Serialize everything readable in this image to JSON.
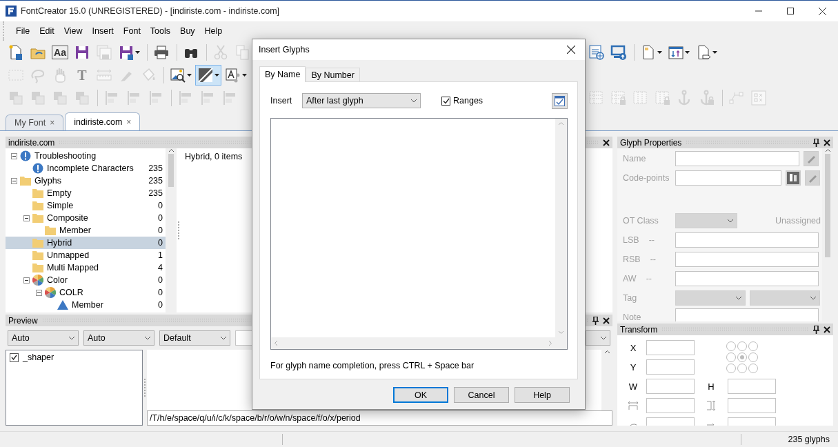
{
  "window": {
    "title": "FontCreator 15.0 (UNREGISTERED) - [indiriste.com - indiriste.com]"
  },
  "menu": [
    "File",
    "Edit",
    "View",
    "Insert",
    "Font",
    "Tools",
    "Buy",
    "Help"
  ],
  "toolbars": [
    {
      "left": [
        [
          {
            "kind": "new",
            "disabled": false,
            "pressed": false
          },
          {
            "kind": "open",
            "disabled": false,
            "pressed": false
          },
          {
            "kind": "sample",
            "label": "Aa",
            "disabled": false,
            "pressed": false
          },
          {
            "kind": "save",
            "disabled": false,
            "pressed": false
          },
          {
            "kind": "saveall",
            "disabled": true,
            "pressed": false
          },
          {
            "kind": "saveas",
            "disabled": false,
            "pressed": false
          }
        ],
        [
          {
            "kind": "print",
            "disabled": false,
            "pressed": false
          }
        ],
        [
          {
            "kind": "find",
            "disabled": false,
            "pressed": false
          }
        ],
        [
          {
            "kind": "cut",
            "disabled": true,
            "pressed": false
          },
          {
            "kind": "copy",
            "disabled": true,
            "pressed": false
          }
        ]
      ],
      "right": [
        [
          {
            "kind": "web",
            "disabled": false,
            "pressed": false
          },
          {
            "kind": "publish",
            "disabled": false,
            "pressed": false
          }
        ],
        [
          {
            "kind": "page",
            "disabled": false,
            "pressed": false
          },
          {
            "kind": "sort",
            "disabled": false,
            "pressed": false
          },
          {
            "kind": "export",
            "disabled": false,
            "pressed": false
          }
        ]
      ]
    },
    {
      "left": [
        [
          {
            "kind": "select",
            "disabled": true,
            "pressed": false
          },
          {
            "kind": "lasso",
            "disabled": true,
            "pressed": false
          },
          {
            "kind": "hand",
            "disabled": true,
            "pressed": false
          },
          {
            "kind": "text",
            "label": "T",
            "disabled": true,
            "pressed": false
          },
          {
            "kind": "measure",
            "disabled": true,
            "pressed": false
          },
          {
            "kind": "knife",
            "disabled": true,
            "pressed": false
          },
          {
            "kind": "fill",
            "disabled": true,
            "pressed": false
          }
        ],
        [
          {
            "kind": "imagezoom",
            "disabled": false,
            "pressed": false
          },
          {
            "kind": "contour",
            "disabled": false,
            "pressed": true
          },
          {
            "kind": "textstyle",
            "disabled": false,
            "pressed": false
          }
        ]
      ]
    },
    {
      "left": [
        [
          {
            "kind": "arrange",
            "disabled": true,
            "pressed": false
          },
          {
            "kind": "arrange",
            "disabled": true,
            "pressed": false
          },
          {
            "kind": "arrange",
            "disabled": true,
            "pressed": false
          },
          {
            "kind": "arrange",
            "disabled": true,
            "pressed": false
          }
        ],
        [
          {
            "kind": "align",
            "disabled": true,
            "pressed": false
          },
          {
            "kind": "align",
            "disabled": true,
            "pressed": false
          },
          {
            "kind": "align",
            "disabled": true,
            "pressed": false
          }
        ],
        [
          {
            "kind": "align",
            "disabled": true,
            "pressed": false
          },
          {
            "kind": "align",
            "disabled": true,
            "pressed": false
          },
          {
            "kind": "align",
            "disabled": true,
            "pressed": false
          }
        ]
      ],
      "right": [
        [
          {
            "kind": "table",
            "disabled": true,
            "pressed": false
          },
          {
            "kind": "tablelock",
            "disabled": true,
            "pressed": false
          },
          {
            "kind": "grid",
            "disabled": true,
            "pressed": false
          },
          {
            "kind": "gridlock",
            "disabled": true,
            "pressed": false
          },
          {
            "kind": "anchor",
            "disabled": true,
            "pressed": false
          },
          {
            "kind": "anchorlock",
            "disabled": true,
            "pressed": false
          }
        ],
        [
          {
            "kind": "node",
            "disabled": true,
            "pressed": false
          },
          {
            "kind": "hint",
            "disabled": true,
            "pressed": false
          }
        ]
      ]
    }
  ],
  "document_tabs": [
    {
      "label": "My Font",
      "close": "×",
      "selected": false
    },
    {
      "label": "indiriste.com",
      "close": "×",
      "selected": true
    }
  ],
  "overview": {
    "title": "indiriste.com",
    "list_caption": "Hybrid, 0 items",
    "tree": [
      {
        "label": "Troubleshooting",
        "kind": "alert",
        "expanded": true,
        "selected": false,
        "children": [
          {
            "label": "Incomplete Characters",
            "kind": "alert",
            "count": "235",
            "selected": false
          }
        ]
      },
      {
        "label": "Glyphs",
        "kind": "folder",
        "count": "235",
        "expanded": true,
        "selected": false,
        "children": [
          {
            "label": "Empty",
            "kind": "folder",
            "count": "235",
            "selected": false
          },
          {
            "label": "Simple",
            "kind": "folder",
            "count": "0",
            "selected": false
          },
          {
            "label": "Composite",
            "kind": "folder",
            "count": "0",
            "expanded": true,
            "selected": false,
            "children": [
              {
                "label": "Member",
                "kind": "folder",
                "count": "0",
                "selected": false
              }
            ]
          },
          {
            "label": "Hybrid",
            "kind": "folder",
            "count": "0",
            "selected": true
          },
          {
            "label": "Unmapped",
            "kind": "folder",
            "count": "1",
            "selected": false
          },
          {
            "label": "Multi Mapped",
            "kind": "folder",
            "count": "4",
            "selected": false
          },
          {
            "label": "Color",
            "kind": "color",
            "count": "0",
            "expanded": true,
            "selected": false,
            "children": [
              {
                "label": "COLR",
                "kind": "color",
                "count": "0",
                "expanded": true,
                "selected": false,
                "children": [
                  {
                    "label": "Member",
                    "kind": "shape",
                    "count": "0",
                    "selected": false
                  }
                ]
              }
            ]
          }
        ]
      }
    ]
  },
  "preview": {
    "title": "Preview",
    "selects": [
      "Auto",
      "Auto",
      "Default"
    ],
    "features": [
      {
        "label": "_shaper",
        "checked": true
      }
    ],
    "text": "/T/h/e/space/q/u/i/c/k/space/b/r/o/w/n/space/f/o/x/period"
  },
  "glyph_properties": {
    "title": "Glyph Properties",
    "disabled": true,
    "fields": [
      {
        "kind": "name",
        "label": "Name"
      },
      {
        "kind": "codepoints",
        "label": "Code-points"
      },
      {
        "kind": "select",
        "label": "OT Class",
        "note": "Unassigned"
      },
      {
        "kind": "metric",
        "label": "LSB",
        "prefix": "--"
      },
      {
        "kind": "metric",
        "label": "RSB",
        "prefix": "--"
      },
      {
        "kind": "metric",
        "label": "AW",
        "prefix": "--"
      },
      {
        "kind": "pair",
        "label": "Tag"
      },
      {
        "kind": "memo",
        "label": "Note"
      }
    ]
  },
  "transform": {
    "title": "Transform",
    "rows": [
      [
        {
          "kind": "label",
          "label": "X"
        }
      ],
      [
        {
          "kind": "label",
          "label": "Y"
        }
      ],
      [
        {
          "kind": "label",
          "label": "W"
        },
        {
          "kind": "label",
          "label": "H"
        }
      ],
      [
        {
          "kind": "hscale"
        },
        {
          "kind": "vscale"
        }
      ],
      [
        {
          "kind": "rotate"
        },
        {
          "kind": "skew"
        }
      ]
    ],
    "anchors": [
      {
        "selected": false
      },
      {
        "selected": false
      },
      {
        "selected": false
      },
      {
        "selected": false
      },
      {
        "selected": true
      },
      {
        "selected": false
      },
      {
        "selected": false
      },
      {
        "selected": false
      },
      {
        "selected": false
      }
    ]
  },
  "status_bar": {
    "glyph_count": "235 glyphs"
  },
  "dialog": {
    "title": "Insert Glyphs",
    "tabs": [
      {
        "label": "By Name",
        "selected": true
      },
      {
        "label": "By Number",
        "selected": false
      }
    ],
    "insert_label": "Insert",
    "insert_value": "After last glyph",
    "ranges": {
      "label": "Ranges",
      "checked": true
    },
    "hint": "For glyph name completion, press CTRL + Space bar",
    "buttons": [
      {
        "label": "OK",
        "default": true
      },
      {
        "label": "Cancel",
        "default": false
      },
      {
        "label": "Help",
        "default": false
      }
    ]
  }
}
